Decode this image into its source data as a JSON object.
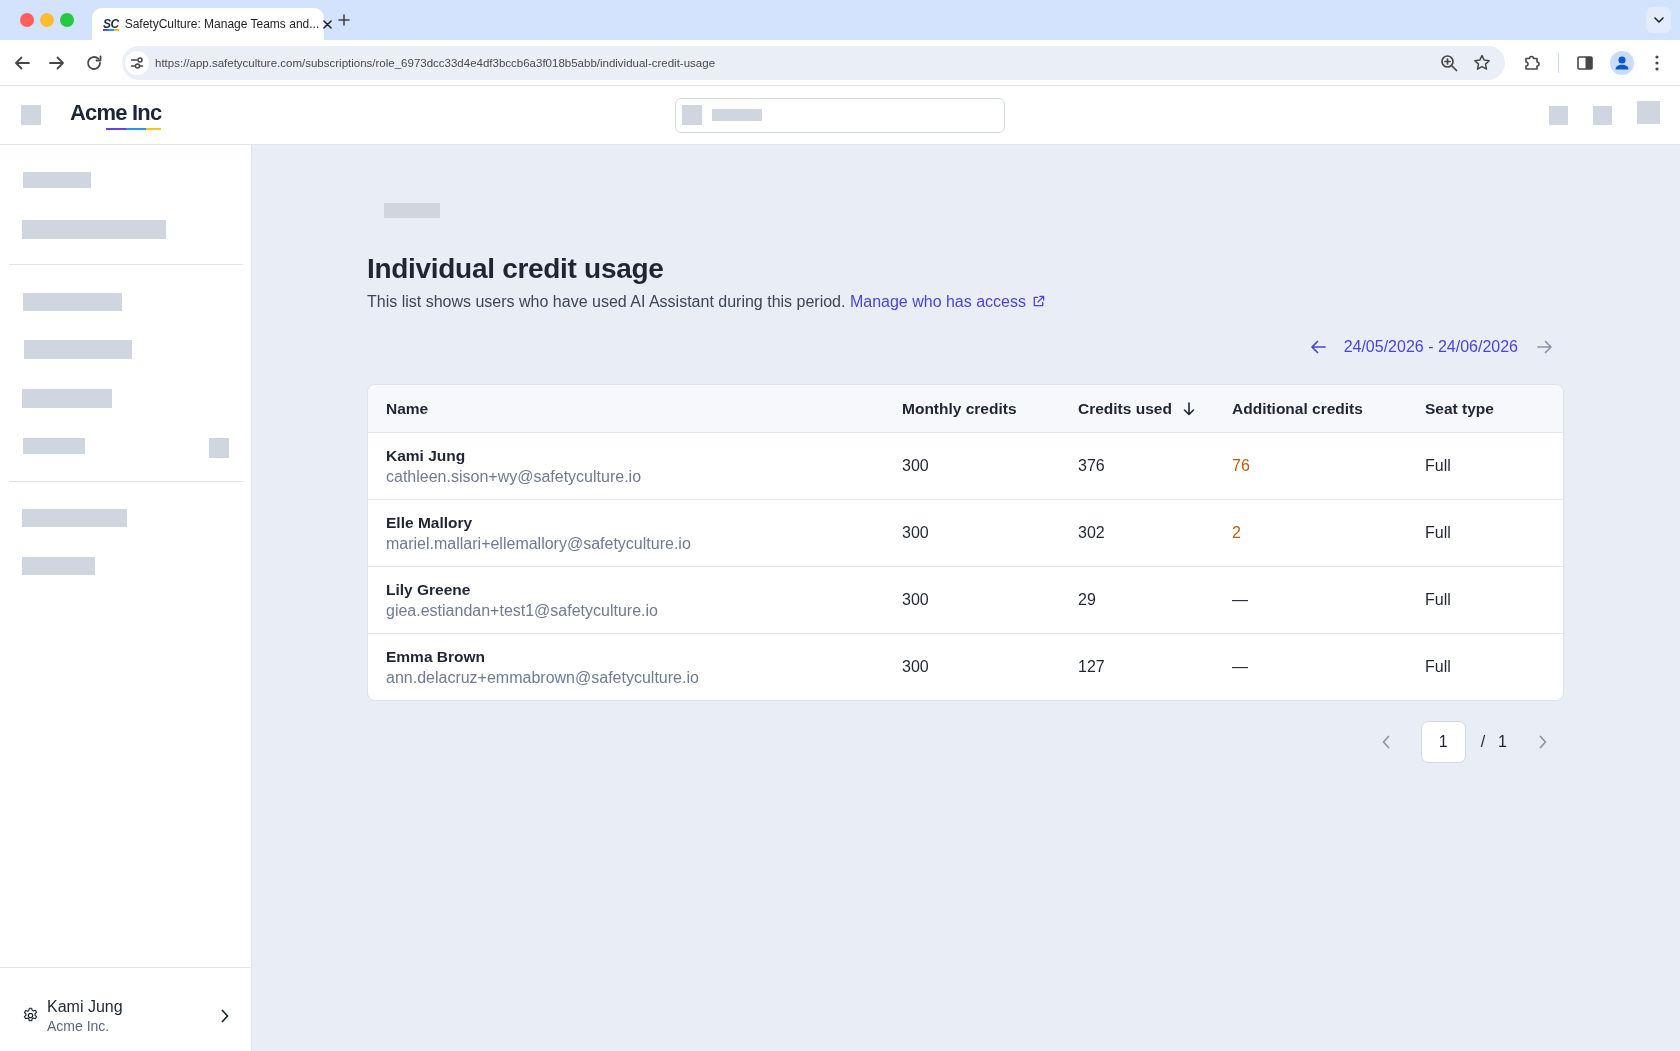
{
  "browser": {
    "tab": {
      "favicon_text": "SC",
      "title": "SafetyCulture: Manage Teams and..."
    },
    "url": "https://app.safetyculture.com/subscriptions/role_6973dcc33d4e4df3bccb6a3f018b5abb/individual-credit-usage"
  },
  "header": {
    "logo": "Acme Inc"
  },
  "sidebar": {
    "user": {
      "name": "Kami Jung",
      "organization": "Acme Inc."
    }
  },
  "page": {
    "title": "Individual credit usage",
    "description": "This list shows users who have used AI Assistant during this period.",
    "link": "Manage who has access"
  },
  "date_range": {
    "text": "24/05/2026 - 24/06/2026",
    "previous_disabled": false,
    "next_disabled": true
  },
  "table": {
    "columns": [
      {
        "label": "Name",
        "sorted": false
      },
      {
        "label": "Monthly credits",
        "sorted": false
      },
      {
        "label": "Credits used",
        "sorted": true
      },
      {
        "label": "Additional credits",
        "sorted": false
      },
      {
        "label": "Seat type",
        "sorted": false
      }
    ],
    "rows": [
      {
        "name": "Kami Jung",
        "email": "cathleen.sison+wy@safetyculture.io",
        "monthly_credits": "300",
        "credits_used": "376",
        "additional_credits": "76",
        "over_limit": true,
        "seat_type": "Full"
      },
      {
        "name": "Elle Mallory",
        "email": "mariel.mallari+ellemallory@safetyculture.io",
        "monthly_credits": "300",
        "credits_used": "302",
        "additional_credits": "2",
        "over_limit": true,
        "seat_type": "Full"
      },
      {
        "name": "Lily Greene",
        "email": "giea.estiandan+test1@safetyculture.io",
        "monthly_credits": "300",
        "credits_used": "29",
        "additional_credits": "—",
        "over_limit": false,
        "seat_type": "Full"
      },
      {
        "name": "Emma Brown",
        "email": "ann.delacruz+emmabrown@safetyculture.io",
        "monthly_credits": "300",
        "credits_used": "127",
        "additional_credits": "—",
        "over_limit": false,
        "seat_type": "Full"
      }
    ]
  },
  "pagination": {
    "page": "1",
    "separator": "/",
    "total": "1",
    "previous_disabled": true,
    "next_disabled": true
  }
}
